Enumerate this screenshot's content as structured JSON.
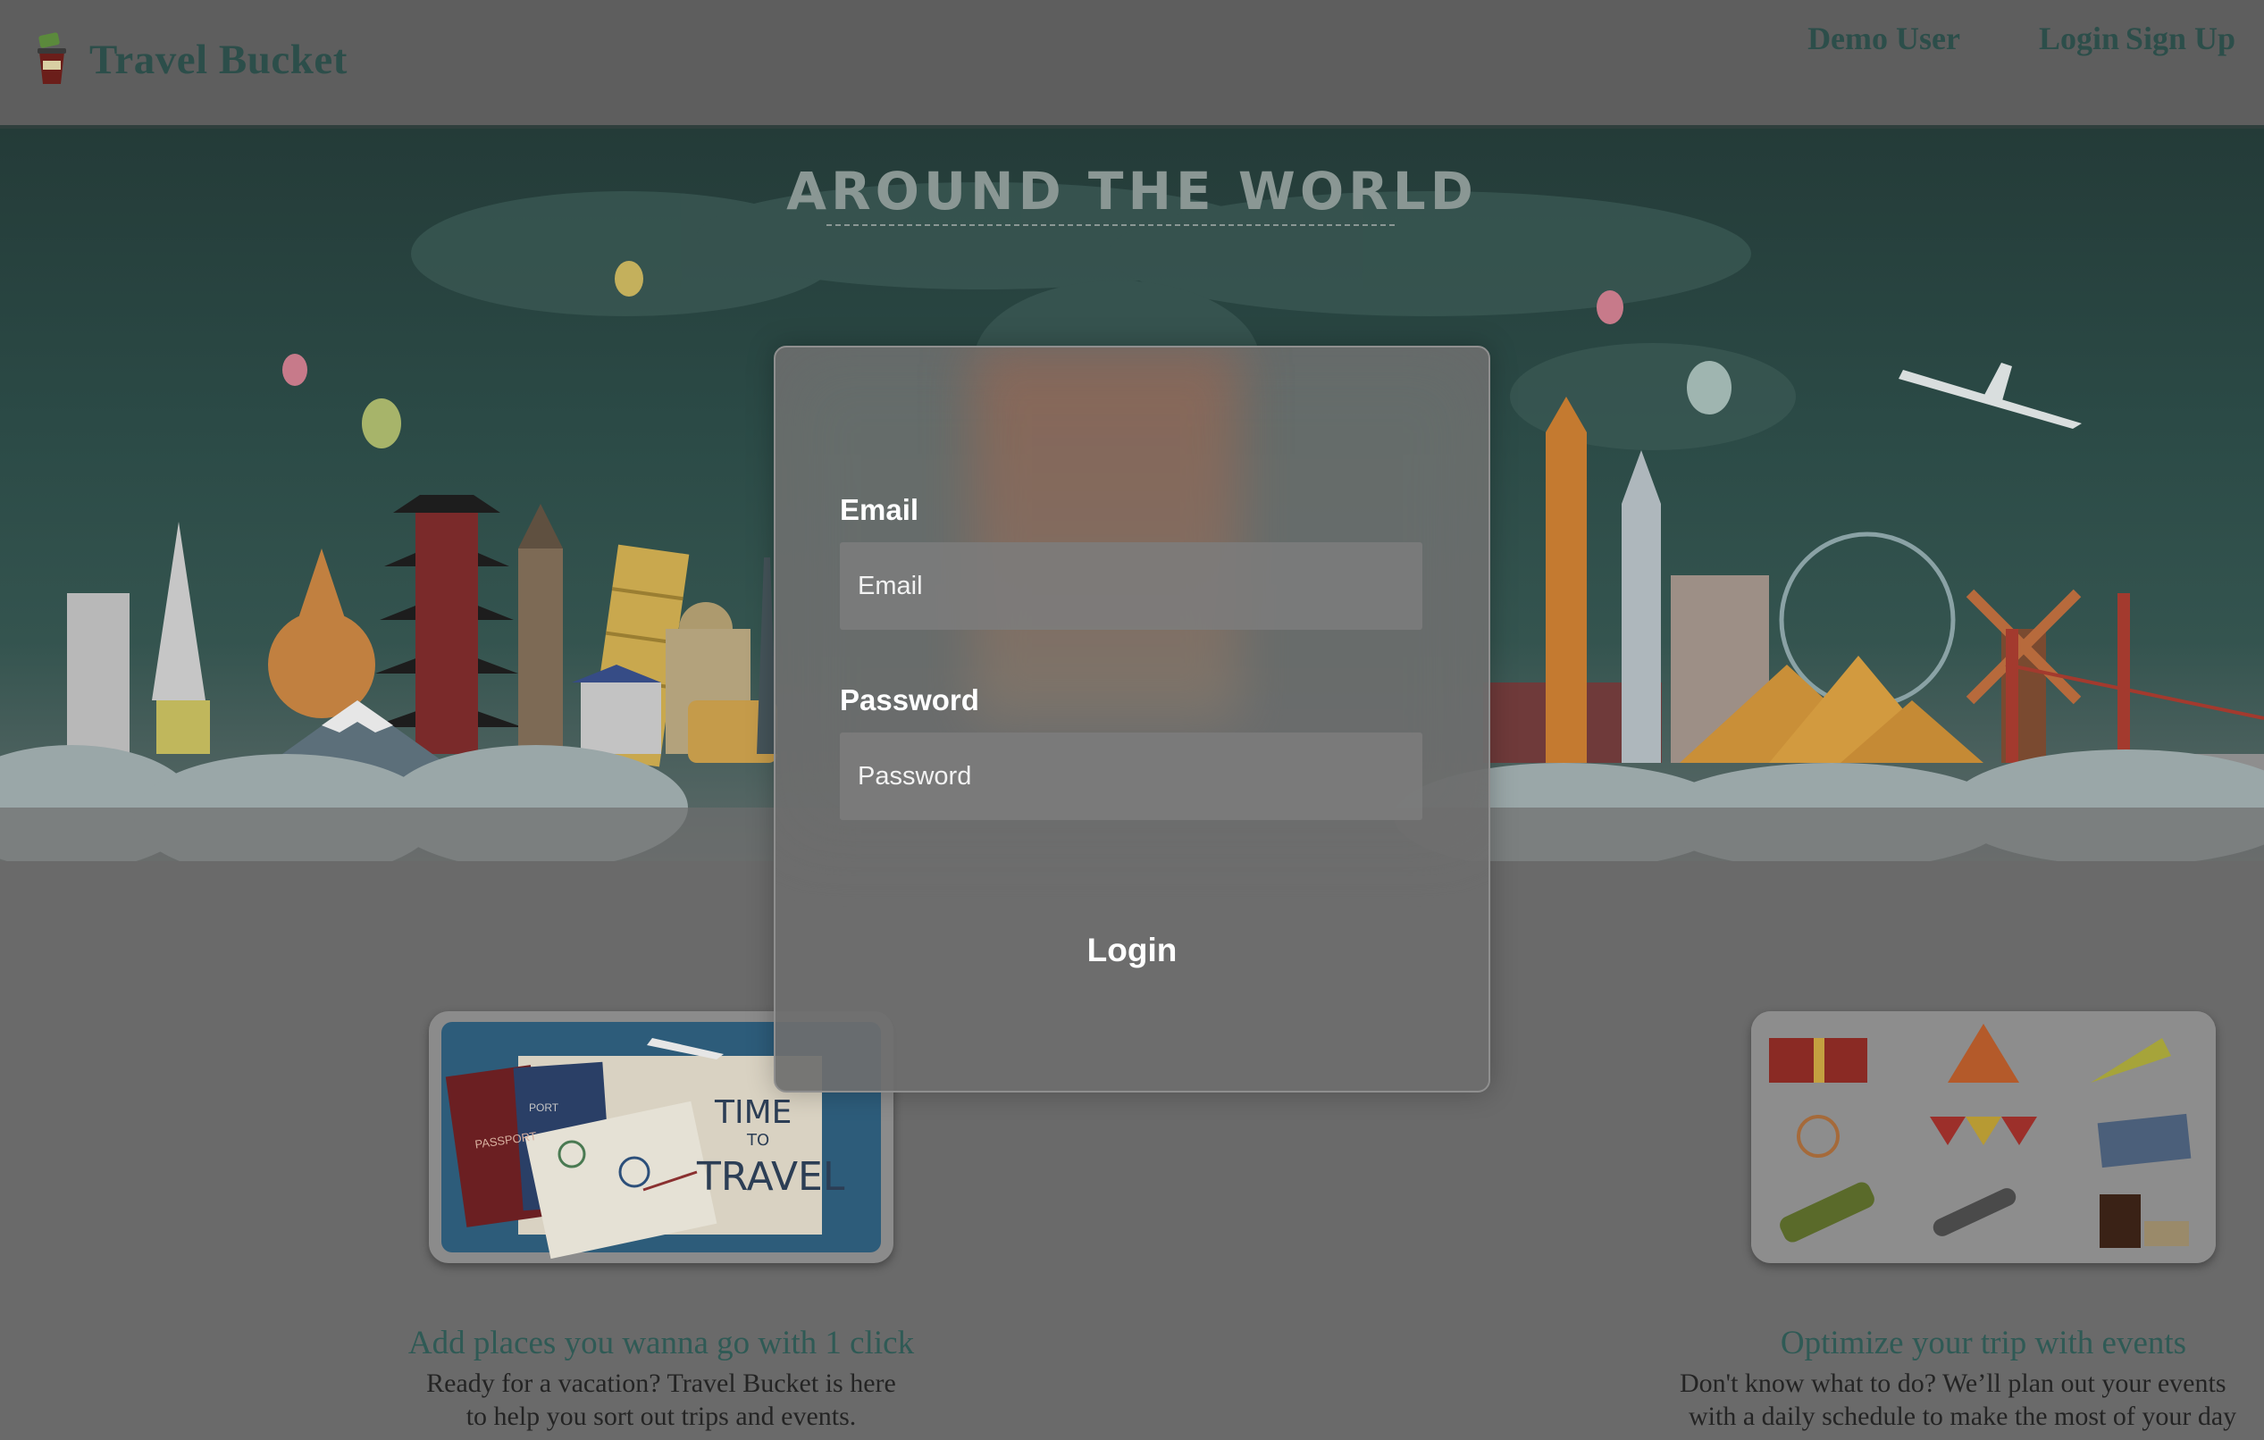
{
  "header": {
    "brand": "Travel Bucket",
    "nav": [
      "Demo User",
      "Login",
      "Sign Up"
    ]
  },
  "hero": {
    "title": "AROUND THE WORLD"
  },
  "features": [
    {
      "title": "Add places you wanna go with 1 click",
      "lines": [
        "Ready for a vacation? Travel Bucket is here",
        "to help you sort out trips and events."
      ],
      "image_caption_lines": [
        "TIME",
        "TO",
        "TRAVEL"
      ],
      "image_tags": [
        "PASSPORT",
        "PORT"
      ]
    },
    {
      "title": "Optimize your trip with events",
      "lines": [
        "Don't know what to do? We’ll plan out your events",
        "with a daily schedule to make the most of your day"
      ]
    }
  ],
  "modal": {
    "email_label": "Email",
    "email_placeholder": "Email",
    "email_value": "",
    "password_label": "Password",
    "password_placeholder": "Password",
    "password_value": "",
    "submit_label": "Login"
  },
  "colors": {
    "brand": "#2c4e4a",
    "overlay": "#6a6a6a",
    "modal_text": "#ffffff"
  },
  "icons": [
    "bucket-logo-icon",
    "gift-icon",
    "party-hat-icon",
    "party-popper-icon",
    "fireworks-icon",
    "bunting-icon",
    "photos-icon",
    "champagne-icon",
    "microphone-icon",
    "liquor-icon"
  ]
}
